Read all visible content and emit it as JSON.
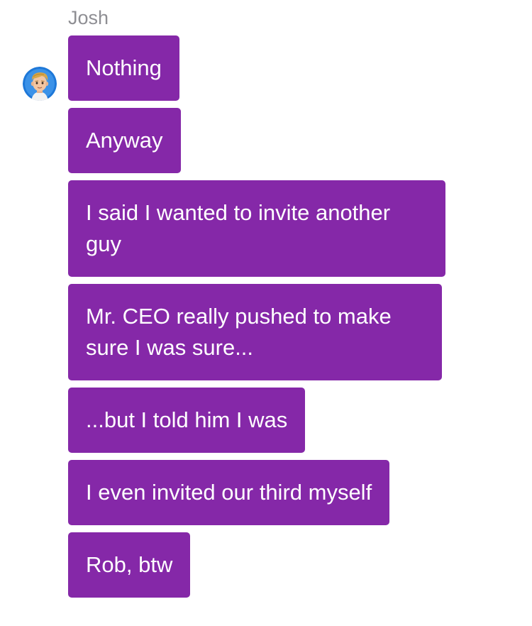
{
  "conversation": {
    "sender_name": "Josh",
    "bubble_color": "#8528a8",
    "text_color": "#ffffff",
    "name_color": "#8e8e93",
    "avatar_icon": "user-avatar-cartoon-blond",
    "messages": [
      "Nothing",
      "Anyway",
      "I said I wanted to invite another guy",
      "Mr. CEO really pushed to make sure I was sure...",
      "...but I told him I was",
      "I even invited our third myself",
      "Rob, btw"
    ]
  }
}
